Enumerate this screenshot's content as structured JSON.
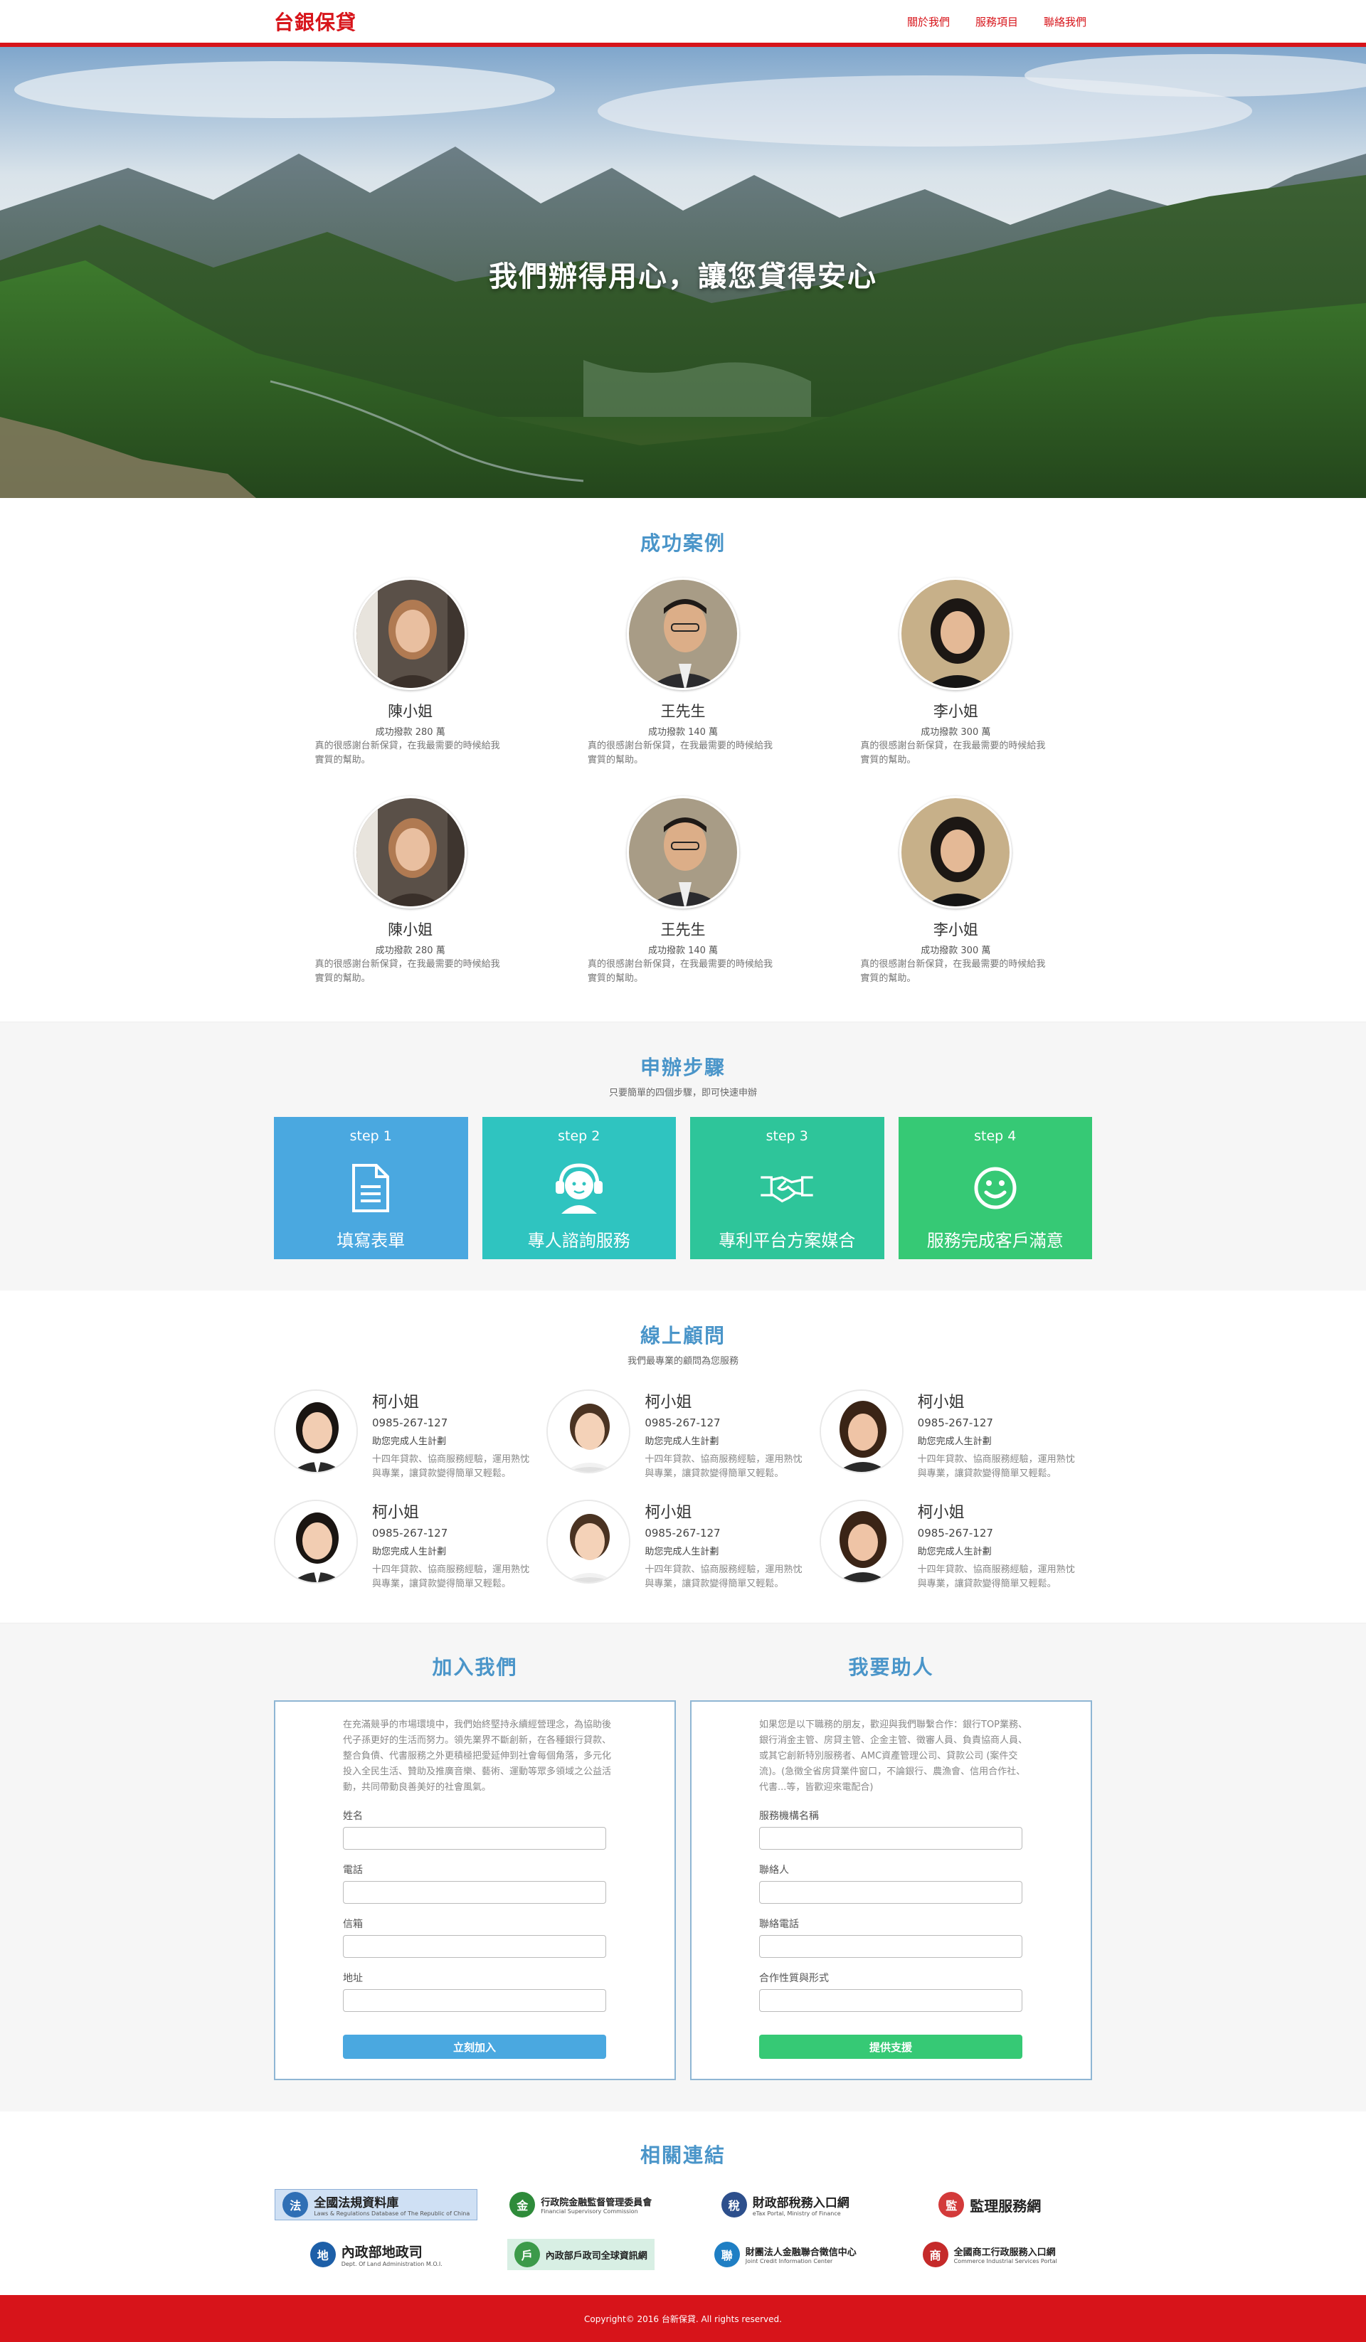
{
  "header": {
    "brand": "台銀保貸",
    "nav": [
      "關於我們",
      "服務項目",
      "聯絡我們"
    ]
  },
  "hero": {
    "slogan": "我們辦得用心，讓您貸得安心"
  },
  "cases": {
    "title": "成功案例",
    "items": [
      {
        "name": "陳小姐",
        "amount": "成功撥款 280 萬",
        "desc": "真的很感謝台新保貸，在我最需要的時候給我實質的幫助。"
      },
      {
        "name": "王先生",
        "amount": "成功撥款 140 萬",
        "desc": "真的很感謝台新保貸，在我最需要的時候給我實質的幫助。"
      },
      {
        "name": "李小姐",
        "amount": "成功撥款 300 萬",
        "desc": "真的很感謝台新保貸，在我最需要的時候給我實質的幫助。"
      },
      {
        "name": "陳小姐",
        "amount": "成功撥款 280 萬",
        "desc": "真的很感謝台新保貸，在我最需要的時候給我實質的幫助。"
      },
      {
        "name": "王先生",
        "amount": "成功撥款 140 萬",
        "desc": "真的很感謝台新保貸，在我最需要的時候給我實質的幫助。"
      },
      {
        "name": "李小姐",
        "amount": "成功撥款 300 萬",
        "desc": "真的很感謝台新保貸，在我最需要的時候給我實質的幫助。"
      }
    ]
  },
  "steps": {
    "title": "申辦步驟",
    "subtitle": "只要簡單的四個步驟，即可快速申辦",
    "items": [
      {
        "label": "step 1",
        "text": "填寫表單",
        "color": "#4aa8e0",
        "icon": "document-icon"
      },
      {
        "label": "step 2",
        "text": "專人諮詢服務",
        "color": "#2fc4c0",
        "icon": "headset-icon"
      },
      {
        "label": "step 3",
        "text": "專利平台方案媒合",
        "color": "#2ec59a",
        "icon": "handshake-icon"
      },
      {
        "label": "step 4",
        "text": "服務完成客戶滿意",
        "color": "#36c975",
        "icon": "smile-icon"
      }
    ]
  },
  "consultants": {
    "title": "線上顧問",
    "subtitle": "我們最專業的顧問為您服務",
    "items": [
      {
        "name": "柯小姐",
        "phone": "0985-267-127",
        "plan": "助您完成人生計劃",
        "desc": "十四年貸款、協商服務經驗，運用熟忱與專業，讓貸款變得簡單又輕鬆。"
      },
      {
        "name": "柯小姐",
        "phone": "0985-267-127",
        "plan": "助您完成人生計劃",
        "desc": "十四年貸款、協商服務經驗，運用熟忱與專業，讓貸款變得簡單又輕鬆。"
      },
      {
        "name": "柯小姐",
        "phone": "0985-267-127",
        "plan": "助您完成人生計劃",
        "desc": "十四年貸款、協商服務經驗，運用熟忱與專業，讓貸款變得簡單又輕鬆。"
      },
      {
        "name": "柯小姐",
        "phone": "0985-267-127",
        "plan": "助您完成人生計劃",
        "desc": "十四年貸款、協商服務經驗，運用熟忱與專業，讓貸款變得簡單又輕鬆。"
      },
      {
        "name": "柯小姐",
        "phone": "0985-267-127",
        "plan": "助您完成人生計劃",
        "desc": "十四年貸款、協商服務經驗，運用熟忱與專業，讓貸款變得簡單又輕鬆。"
      },
      {
        "name": "柯小姐",
        "phone": "0985-267-127",
        "plan": "助您完成人生計劃",
        "desc": "十四年貸款、協商服務經驗，運用熟忱與專業，讓貸款變得簡單又輕鬆。"
      }
    ]
  },
  "join": {
    "title": "加入我們",
    "intro": "在充滿競爭的市場環境中，我們始終堅持永續經營理念，為協助後代子孫更好的生活而努力。領先業界不斷創新，在各種銀行貸款、整合負債、代書服務之外更積極把愛延伸到社會每個角落，多元化投入全民生活、贊助及推廣音樂、藝術、運動等眾多領域之公益活動，共同帶動良善美好的社會風氣。",
    "fields": [
      "姓名",
      "電話",
      "信箱",
      "地址"
    ],
    "button": "立刻加入",
    "button_color": "#4aa8e0"
  },
  "help": {
    "title": "我要助人",
    "intro": "如果您是以下職務的朋友，歡迎與我們聯繫合作：銀行TOP業務、銀行消金主管、房貸主管、企金主管、徵審人員、負責協商人員、或其它創新特別服務者、AMC資產管理公司、貸款公司 (案件交流)。(急徵全省房貸業件窗口，不論銀行、農漁會、信用合作社、代書...等，皆歡迎來電配合)",
    "fields": [
      "服務機構名稱",
      "聯絡人",
      "聯絡電話",
      "合作性質與形式"
    ],
    "button": "提供支援",
    "button_color": "#36c975"
  },
  "links": {
    "title": "相關連結",
    "items": [
      {
        "title": "全國法規資料庫",
        "sub": "Laws & Regulations Database of The Republic of China",
        "color": "#2f6fb5",
        "icon": "law-database-icon"
      },
      {
        "title": "行政院金融監督管理委員會",
        "sub": "Financial Supervisory Commission",
        "color": "#2e8b3a",
        "icon": "fsc-icon"
      },
      {
        "title": "財政部稅務入口網",
        "sub": "eTax Portal, Ministry of Finance",
        "color": "#2d4f8c",
        "icon": "etax-icon"
      },
      {
        "title": "監理服務網",
        "sub": "",
        "color": "#d33a3a",
        "icon": "mvdis-icon"
      },
      {
        "title": "內政部地政司",
        "sub": "Dept. Of Land Administration M.O.I.",
        "color": "#1d5fa8",
        "icon": "land-admin-icon"
      },
      {
        "title": "內政部戶政司全球資訊網",
        "sub": "",
        "color": "#3c9a4a",
        "icon": "household-icon"
      },
      {
        "title": "財團法人金融聯合徵信中心",
        "sub": "Joint Credit Information Center",
        "color": "#1f7fc4",
        "icon": "jcic-icon"
      },
      {
        "title": "全國商工行政服務入口網",
        "sub": "Commerce Industrial Services Portal",
        "color": "#c52a2a",
        "icon": "commerce-portal-icon"
      }
    ]
  },
  "footer": {
    "copyright": "Copyright© 2016 台新保貸. All rights reserved."
  }
}
